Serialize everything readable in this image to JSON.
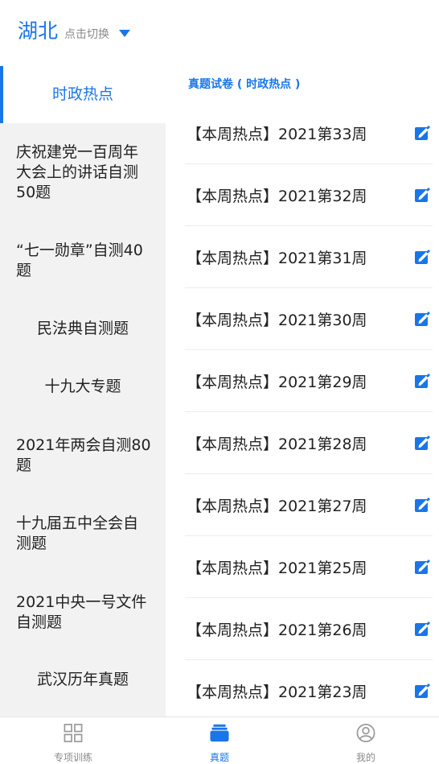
{
  "header": {
    "region": "湖北",
    "region_hint": "点击切换",
    "accent_color": "#1976e8"
  },
  "sidebar": {
    "items": [
      {
        "label": "时政热点",
        "active": true
      },
      {
        "label": "庆祝建党一百周年大会上的讲话自测50题",
        "active": false
      },
      {
        "label": "“七一勋章”自测40题",
        "active": false
      },
      {
        "label": "民法典自测题",
        "active": false
      },
      {
        "label": "十九大专题",
        "active": false
      },
      {
        "label": "2021年两会自测80题",
        "active": false
      },
      {
        "label": "十九届五中全会自测题",
        "active": false
      },
      {
        "label": "2021中央一号文件自测题",
        "active": false
      },
      {
        "label": "武汉历年真题",
        "active": false
      }
    ]
  },
  "main": {
    "section_title": "真题试卷 ( 时政热点 )",
    "rows": [
      {
        "title": "【本周热点】2021第33周",
        "icon": "edit-icon"
      },
      {
        "title": "【本周热点】2021第32周",
        "icon": "edit-icon"
      },
      {
        "title": "【本周热点】2021第31周",
        "icon": "edit-icon"
      },
      {
        "title": "【本周热点】2021第30周",
        "icon": "edit-icon"
      },
      {
        "title": "【本周热点】2021第29周",
        "icon": "edit-icon"
      },
      {
        "title": "【本周热点】2021第28周",
        "icon": "edit-icon"
      },
      {
        "title": "【本周热点】2021第27周",
        "icon": "edit-icon"
      },
      {
        "title": "【本周热点】2021第25周",
        "icon": "edit-icon"
      },
      {
        "title": "【本周热点】2021第26周",
        "icon": "edit-icon"
      },
      {
        "title": "【本周热点】2021第23周",
        "icon": "edit-icon"
      }
    ]
  },
  "tabbar": {
    "tabs": [
      {
        "label": "专项训练",
        "icon": "grid-icon",
        "active": false
      },
      {
        "label": "真题",
        "icon": "papers-icon",
        "active": true
      },
      {
        "label": "我的",
        "icon": "user-icon",
        "active": false
      }
    ]
  }
}
